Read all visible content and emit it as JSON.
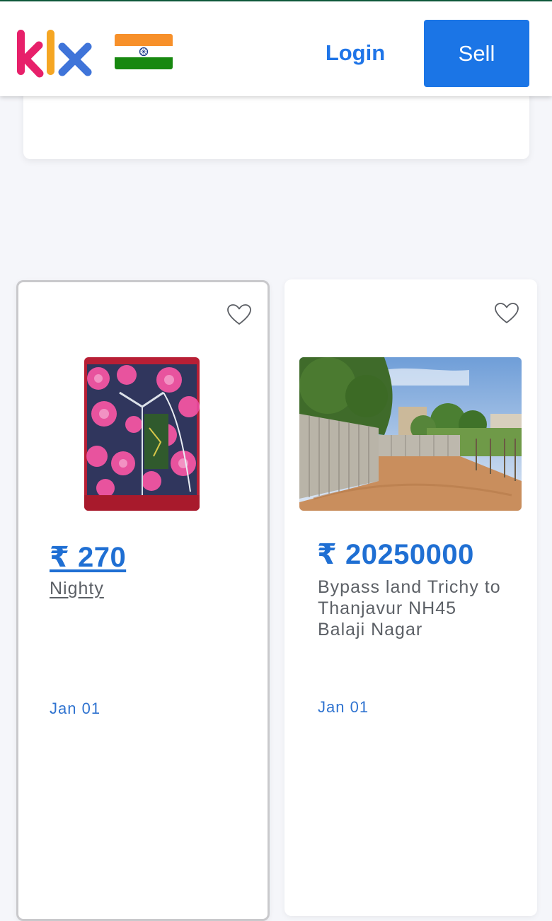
{
  "header": {
    "logo_text": "klx",
    "country": "India",
    "login_label": "Login",
    "sell_label": "Sell"
  },
  "colors": {
    "accent": "#1b75e6",
    "price": "#1f6fd3",
    "logo_k": "#e7206a",
    "logo_l": "#f5a623",
    "logo_x": "#3f74d9"
  },
  "listings": [
    {
      "price": "₹ 270",
      "title": "Nighty",
      "date": "Jan 01",
      "icon": "heart-outline-icon",
      "selected": true
    },
    {
      "price": "₹ 20250000",
      "title": "Bypass land Trichy to Thanjavur NH45 Balaji Nagar",
      "date": "Jan 01",
      "icon": "heart-outline-icon",
      "selected": false
    }
  ]
}
